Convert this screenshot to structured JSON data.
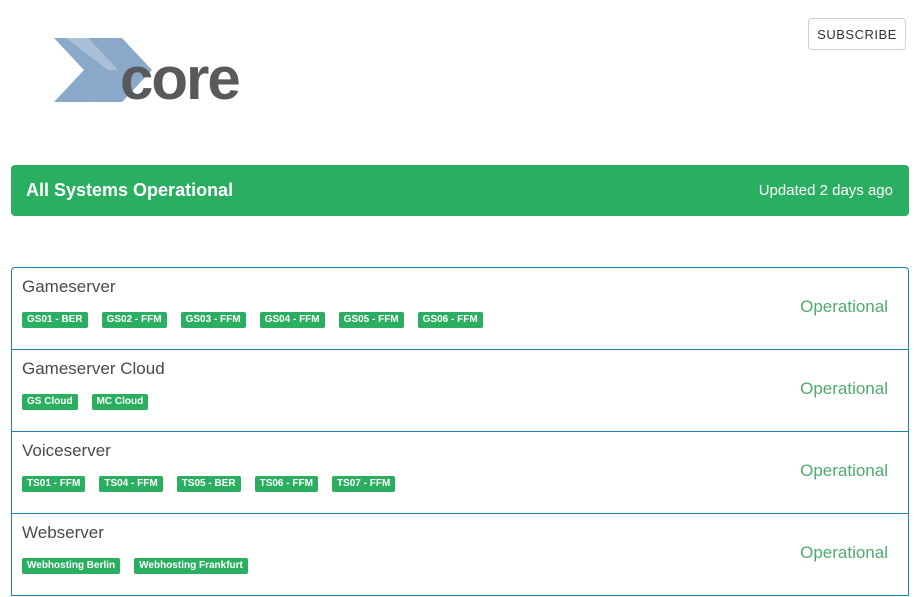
{
  "brand": {
    "logo_text": "Xcore",
    "logo_colors": {
      "x": "#8aa9c9",
      "core": "#58595b"
    }
  },
  "header": {
    "subscribe_label": "SUBSCRIBE"
  },
  "status": {
    "title": "All Systems Operational",
    "updated": "Updated 2 days ago",
    "color": "#2aae60"
  },
  "components": [
    {
      "name": "Gameserver",
      "status": "Operational",
      "tags": [
        "GS01 - BER",
        "GS02 - FFM",
        "GS03 - FFM",
        "GS04 - FFM",
        "GS05 - FFM",
        "GS06 - FFM"
      ]
    },
    {
      "name": "Gameserver Cloud",
      "status": "Operational",
      "tags": [
        "GS Cloud",
        "MC Cloud"
      ]
    },
    {
      "name": "Voiceserver",
      "status": "Operational",
      "tags": [
        "TS01 - FFM",
        "TS04 - FFM",
        "TS05 - BER",
        "TS06 - FFM",
        "TS07 - FFM"
      ]
    },
    {
      "name": "Webserver",
      "status": "Operational",
      "tags": [
        "Webhosting Berlin",
        "Webhosting Frankfurt"
      ]
    }
  ]
}
